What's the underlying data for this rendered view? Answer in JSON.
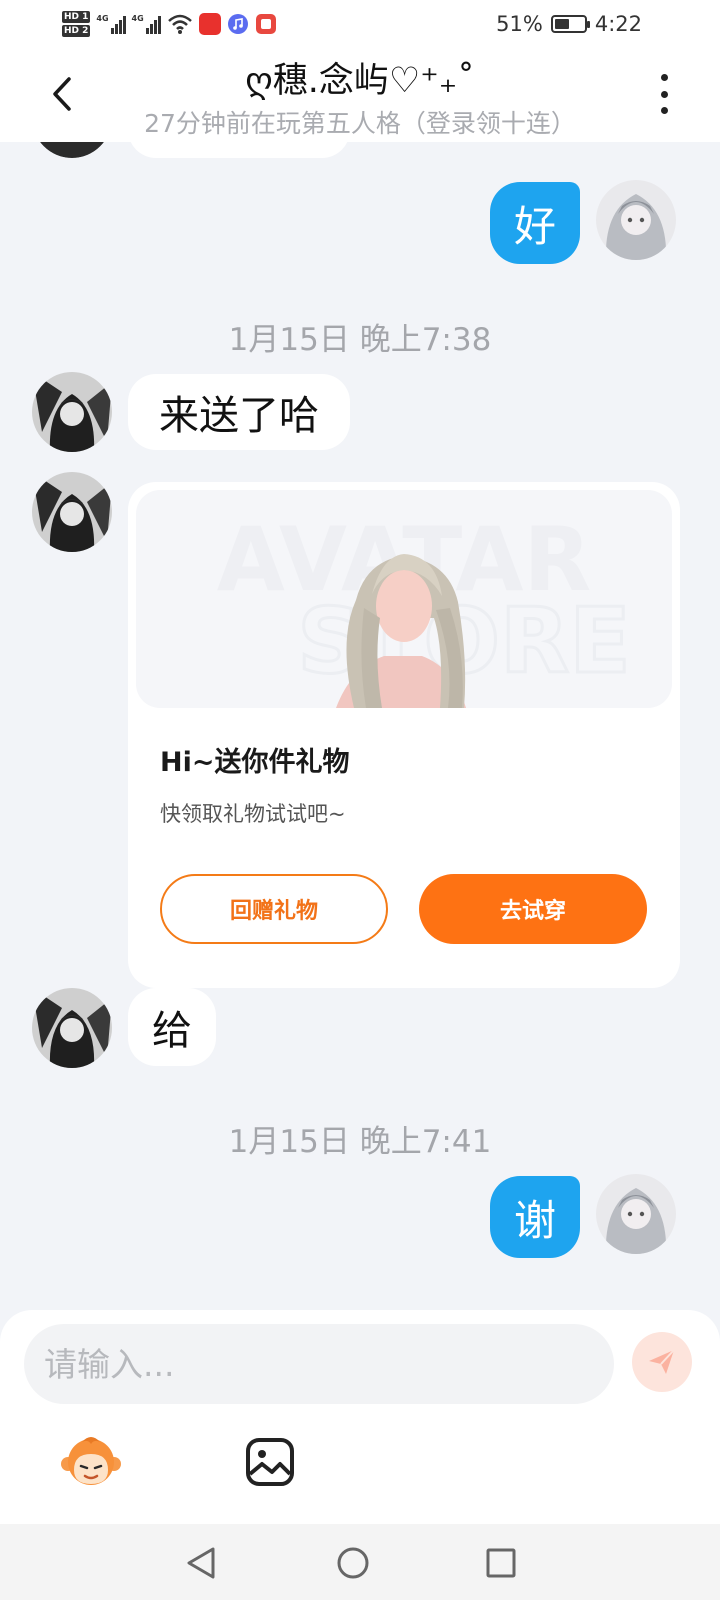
{
  "status_bar": {
    "sim1": "HD 1",
    "sim2": "HD 2",
    "signal1_label": "4G",
    "signal2_label": "4G",
    "battery_percent": "51%",
    "battery_level": 0.51,
    "time": "4:22",
    "icons": [
      "hd-icon",
      "signal-icon",
      "wifi-icon",
      "app-notification-icon",
      "music-icon",
      "red-app-icon"
    ]
  },
  "header": {
    "back_icon": "chevron-left-icon",
    "title": "ღ穗.念屿♡⁺₊˚",
    "subtitle": "27分钟前在玩第五人格（登录领十连）",
    "more_icon": "more-vertical-icon"
  },
  "messages": {
    "m1": {
      "side": "right",
      "text": "好"
    },
    "ts1": "1月15日 晚上7:38",
    "m2": {
      "side": "left",
      "text": "来送了哈"
    },
    "gift": {
      "watermark_line1": "AVATAR",
      "watermark_line2": "STORE",
      "title": "Hi~送你件礼物",
      "desc": "快领取礼物试试吧~",
      "return_label": "回赠礼物",
      "try_label": "去试穿"
    },
    "m3": {
      "side": "left",
      "text": "给"
    },
    "ts2": "1月15日 晚上7:41",
    "m4": {
      "side": "right",
      "text": "谢"
    }
  },
  "input_bar": {
    "placeholder": "请输入...",
    "value": "",
    "send_icon": "send-icon",
    "emoji_icon": "emoji-monkey-icon",
    "image_icon": "image-icon"
  },
  "nav_bar": {
    "back_icon": "nav-back-icon",
    "home_icon": "nav-home-icon",
    "recents_icon": "nav-recents-icon"
  },
  "colors": {
    "accent_blue": "#1ea4ef",
    "accent_orange": "#fe7213",
    "background": "#f2f4f8"
  }
}
